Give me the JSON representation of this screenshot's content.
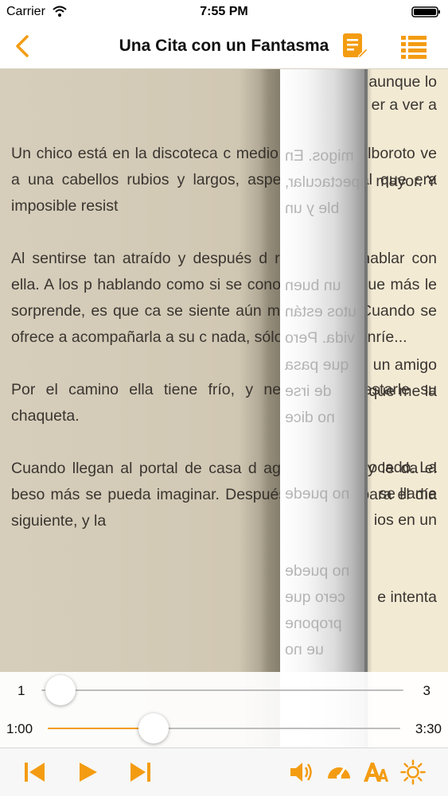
{
  "status_bar": {
    "carrier": "Carrier",
    "time": "7:55 PM"
  },
  "nav": {
    "title": "Una Cita con un Fantasma"
  },
  "colors": {
    "accent": "#f39c12",
    "page_bg": "#f4ecd9"
  },
  "icons": {
    "back": "chevron-left-icon",
    "note": "note-edit-icon",
    "list": "list-icon",
    "prev": "skip-back-icon",
    "play": "play-icon",
    "next": "skip-forward-icon",
    "volume": "speaker-icon",
    "speed": "speedometer-icon",
    "font": "font-size-icon",
    "brightness": "brightness-icon"
  },
  "page": {
    "paragraphs": [
      "Un chico está en la discoteca c medio de todo el alboroto ve a una cabellos rubios y largos, aspec encanto al que era imposible resist",
      "Al sentirse tan atraído y después d rato decide hablar con ella. A los p hablando como si se conocieran d lo que más le sorprende, es que ca se siente aún más atraído. Cuando se ofrece a acompañarla a su c nada, sólo sonríe, y sonríe...",
      "Por el camino ella tiene frío, y negarse a prestarle su chaqueta.",
      "Cuando llegan al portal de casa d aguantar más y le da el beso más se pueda imaginar. Después d quedar para el día siguiente, y la"
    ],
    "back_lines": [
      {
        "text": "aunque lo",
        "line": 0
      },
      {
        "text": "er a ver a",
        "line": 1
      },
      {
        "text": "mayor. Y",
        "line": 4
      },
      {
        "text": "un amigo",
        "line": 11
      },
      {
        "text": "que me la",
        "line": 12
      },
      {
        "text": "ocado. La",
        "line": 15
      },
      {
        "text": "se llame",
        "line": 16
      },
      {
        "text": "ios en un",
        "line": 17
      },
      {
        "text": "e intenta",
        "line": 20
      }
    ],
    "mirror_lines": [
      {
        "text": "migos. En",
        "line": 3
      },
      {
        "text": "espectacular,",
        "line": 4
      },
      {
        "text": "ble y un",
        "line": 5
      },
      {
        "text": "un buen",
        "line": 8
      },
      {
        "text": "utos están",
        "line": 9
      },
      {
        "text": "vida. Pero",
        "line": 10
      },
      {
        "text": "que pasa",
        "line": 11
      },
      {
        "text": "de irse",
        "line": 12
      },
      {
        "text": "no dice",
        "line": 13
      },
      {
        "text": "no puede",
        "line": 16
      },
      {
        "text": "no puede",
        "line": 19
      },
      {
        "text": "cero que",
        "line": 20
      },
      {
        "text": "propone",
        "line": 21
      },
      {
        "text": "ue no",
        "line": 22
      }
    ]
  },
  "page_slider": {
    "start_label": "1",
    "end_label": "3",
    "value_fraction": 0.04
  },
  "time_slider": {
    "start_label": "1:00",
    "end_label": "3:30",
    "value_fraction": 0.3
  }
}
